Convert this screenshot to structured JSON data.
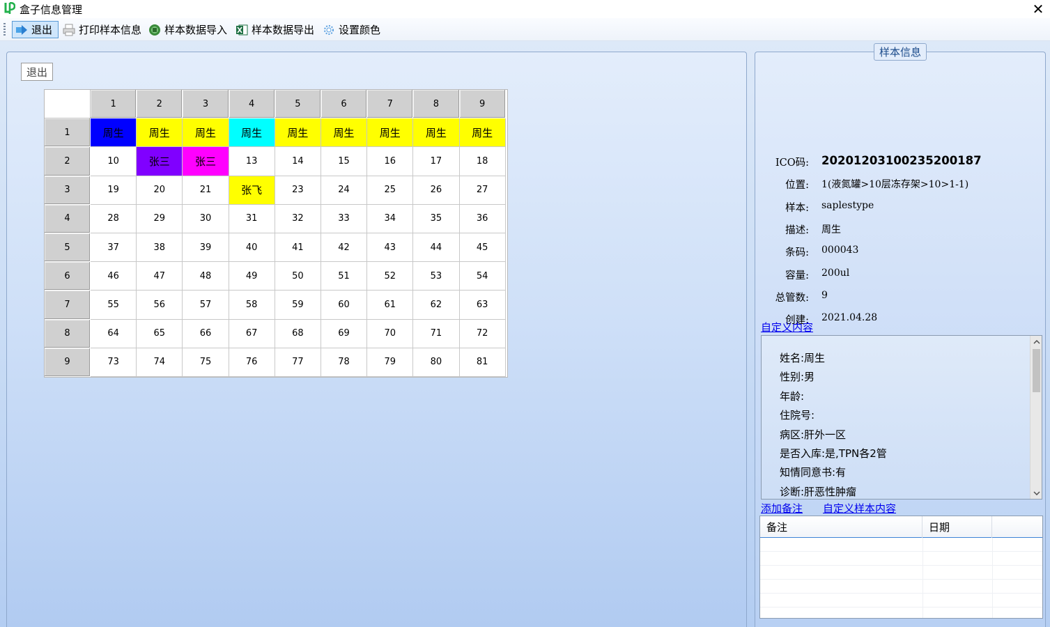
{
  "window": {
    "title": "盒子信息管理",
    "close_glyph": "✕"
  },
  "toolbar": {
    "exit": {
      "label": "退出",
      "icon": "exit-icon"
    },
    "print": {
      "label": "打印样本信息",
      "icon": "printer-icon"
    },
    "import": {
      "label": "样本数据导入",
      "icon": "import-icon"
    },
    "export": {
      "label": "样本数据导出",
      "icon": "excel-icon"
    },
    "color": {
      "label": "设置颜色",
      "icon": "gear-icon"
    }
  },
  "left_panel": {
    "exit_button": "退出"
  },
  "grid": {
    "columns": [
      "1",
      "2",
      "3",
      "4",
      "5",
      "6",
      "7",
      "8",
      "9"
    ],
    "rows": [
      {
        "label": "1",
        "cells": [
          {
            "text": "周生",
            "bg": "#0000ff"
          },
          {
            "text": "周生",
            "bg": "#ffff00"
          },
          {
            "text": "周生",
            "bg": "#ffff00"
          },
          {
            "text": "周生",
            "bg": "#00ffff"
          },
          {
            "text": "周生",
            "bg": "#ffff00"
          },
          {
            "text": "周生",
            "bg": "#ffff00"
          },
          {
            "text": "周生",
            "bg": "#ffff00"
          },
          {
            "text": "周生",
            "bg": "#ffff00"
          },
          {
            "text": "周生",
            "bg": "#ffff00"
          }
        ]
      },
      {
        "label": "2",
        "cells": [
          {
            "text": "10"
          },
          {
            "text": "张三",
            "bg": "#8000ff"
          },
          {
            "text": "张三",
            "bg": "#ff00ff"
          },
          {
            "text": "13"
          },
          {
            "text": "14"
          },
          {
            "text": "15"
          },
          {
            "text": "16"
          },
          {
            "text": "17"
          },
          {
            "text": "18"
          }
        ]
      },
      {
        "label": "3",
        "cells": [
          {
            "text": "19"
          },
          {
            "text": "20"
          },
          {
            "text": "21"
          },
          {
            "text": "张飞",
            "bg": "#ffff00"
          },
          {
            "text": "23"
          },
          {
            "text": "24"
          },
          {
            "text": "25"
          },
          {
            "text": "26"
          },
          {
            "text": "27"
          }
        ]
      },
      {
        "label": "4",
        "cells": [
          {
            "text": "28"
          },
          {
            "text": "29"
          },
          {
            "text": "30"
          },
          {
            "text": "31"
          },
          {
            "text": "32"
          },
          {
            "text": "33"
          },
          {
            "text": "34"
          },
          {
            "text": "35"
          },
          {
            "text": "36"
          }
        ]
      },
      {
        "label": "5",
        "cells": [
          {
            "text": "37"
          },
          {
            "text": "38"
          },
          {
            "text": "39"
          },
          {
            "text": "40"
          },
          {
            "text": "41"
          },
          {
            "text": "42"
          },
          {
            "text": "43"
          },
          {
            "text": "44"
          },
          {
            "text": "45"
          }
        ]
      },
      {
        "label": "6",
        "cells": [
          {
            "text": "46"
          },
          {
            "text": "47"
          },
          {
            "text": "48"
          },
          {
            "text": "49"
          },
          {
            "text": "50"
          },
          {
            "text": "51"
          },
          {
            "text": "52"
          },
          {
            "text": "53"
          },
          {
            "text": "54"
          }
        ]
      },
      {
        "label": "7",
        "cells": [
          {
            "text": "55"
          },
          {
            "text": "56"
          },
          {
            "text": "57"
          },
          {
            "text": "58"
          },
          {
            "text": "59"
          },
          {
            "text": "60"
          },
          {
            "text": "61"
          },
          {
            "text": "62"
          },
          {
            "text": "63"
          }
        ]
      },
      {
        "label": "8",
        "cells": [
          {
            "text": "64"
          },
          {
            "text": "65"
          },
          {
            "text": "66"
          },
          {
            "text": "67"
          },
          {
            "text": "68"
          },
          {
            "text": "69"
          },
          {
            "text": "70"
          },
          {
            "text": "71"
          },
          {
            "text": "72"
          }
        ]
      },
      {
        "label": "9",
        "cells": [
          {
            "text": "73"
          },
          {
            "text": "74"
          },
          {
            "text": "75"
          },
          {
            "text": "76"
          },
          {
            "text": "77"
          },
          {
            "text": "78"
          },
          {
            "text": "79"
          },
          {
            "text": "80"
          },
          {
            "text": "81"
          }
        ]
      }
    ]
  },
  "sample_info": {
    "title": "样本信息",
    "fields": [
      {
        "label": "ICO码:",
        "value": "20201203100235200187"
      },
      {
        "label": "位置:",
        "value": "1(液氮罐>10层冻存架>10>1-1)"
      },
      {
        "label": "样本:",
        "value": "saplestype"
      },
      {
        "label": "描述:",
        "value": "周生"
      },
      {
        "label": "条码:",
        "value": "000043"
      },
      {
        "label": "容量:",
        "value": "200ul"
      },
      {
        "label": "总管数:",
        "value": "9"
      },
      {
        "label": "创建:",
        "value": "2021.04.28"
      }
    ]
  },
  "custom_content": {
    "link": "自定义内容",
    "lines": [
      "姓名:周生",
      "性别:男",
      "年龄:",
      "住院号:",
      "病区:肝外一区",
      "是否入库:是,TPN各2管",
      "知情同意书:有",
      "诊断:肝恶性肿瘤"
    ]
  },
  "actions": {
    "add_note": "添加备注",
    "custom_sample": "自定义样本内容"
  },
  "notes_table": {
    "columns": [
      "备注",
      "日期"
    ]
  },
  "colors": {
    "selected_blue": "#0000ff",
    "yellow": "#ffff00",
    "cyan": "#00ffff",
    "purple": "#8000ff",
    "magenta": "#ff00ff",
    "link": "#0000ee"
  }
}
